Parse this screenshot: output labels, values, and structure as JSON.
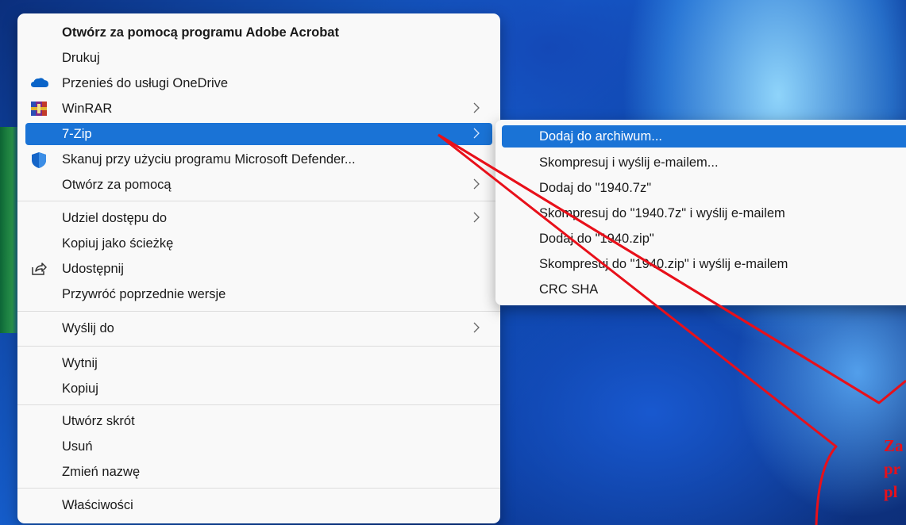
{
  "context_menu": {
    "items": [
      {
        "label": "Otwórz za pomocą programu Adobe Acrobat"
      },
      {
        "label": "Drukuj"
      },
      {
        "label": "Przenieś do usługi OneDrive",
        "icon": "onedrive-cloud-icon"
      },
      {
        "label": "WinRAR",
        "icon": "winrar-icon"
      },
      {
        "label": "7-Zip",
        "state": "highlighted"
      },
      {
        "label": "Skanuj przy użyciu programu Microsoft Defender...",
        "icon": "defender-shield-icon"
      },
      {
        "label": "Otwórz za pomocą"
      },
      {
        "label": "Udziel dostępu do"
      },
      {
        "label": "Kopiuj jako ścieżkę"
      },
      {
        "label": "Udostępnij",
        "icon": "share-icon"
      },
      {
        "label": "Przywróć poprzednie wersje"
      },
      {
        "label": "Wyślij do"
      },
      {
        "label": "Wytnij"
      },
      {
        "label": "Kopiuj"
      },
      {
        "label": "Utwórz skrót"
      },
      {
        "label": "Usuń"
      },
      {
        "label": "Zmień nazwę"
      },
      {
        "label": "Właściwości"
      }
    ]
  },
  "submenu_7zip": {
    "items": [
      {
        "label": "Dodaj do archiwum...",
        "state": "highlighted"
      },
      {
        "label": "Skompresuj i wyślij e-mailem..."
      },
      {
        "label": "Dodaj do \"1940.7z\""
      },
      {
        "label": "Skompresuj do \"1940.7z\" i wyślij e-mailem"
      },
      {
        "label": "Dodaj do \"1940.zip\""
      },
      {
        "label": "Skompresuj do \"1940.zip\" i wyślij e-mailem"
      },
      {
        "label": "CRC SHA"
      }
    ]
  },
  "annotation": {
    "text_lines": [
      "Za",
      "pr",
      "pl"
    ],
    "color": "#e8101a"
  },
  "colors": {
    "highlight": "#1a73d6",
    "menu_bg": "#f9f9f9"
  }
}
